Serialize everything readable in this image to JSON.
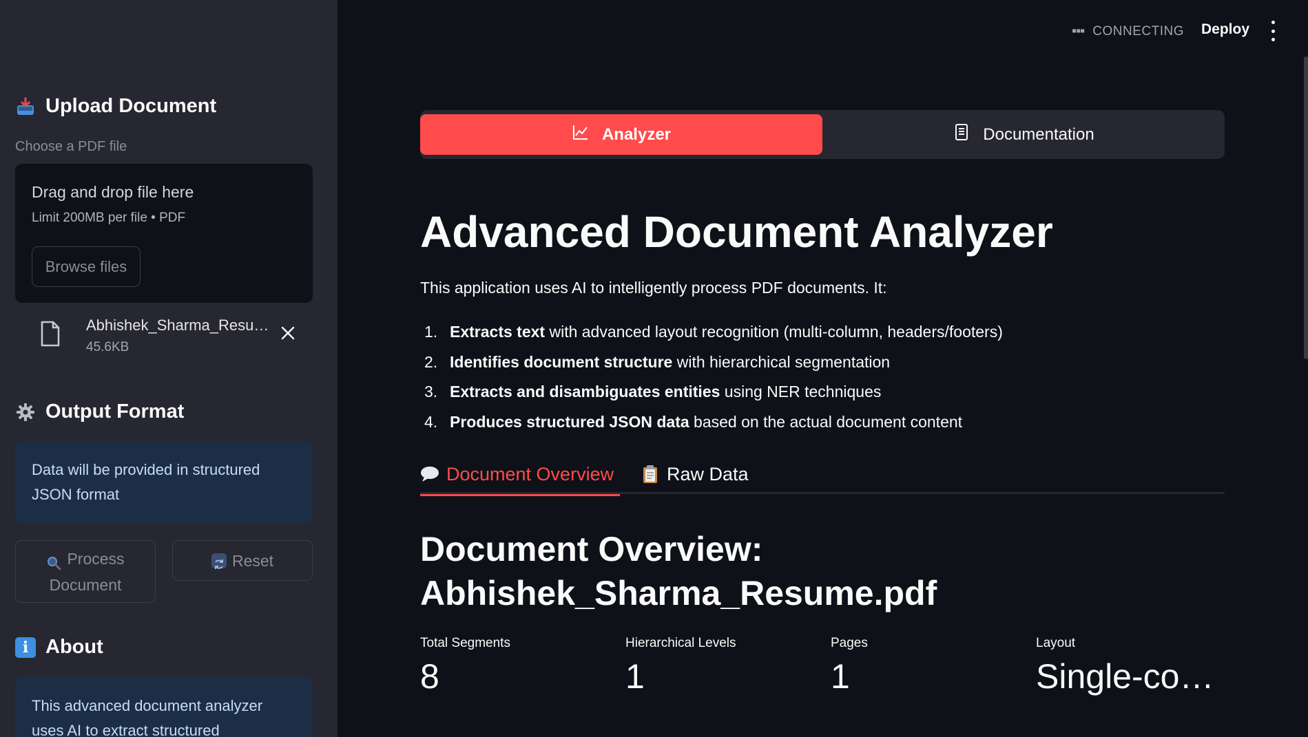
{
  "sidebar": {
    "upload_heading": "Upload Document",
    "file_label": "Choose a PDF file",
    "dropzone": {
      "title": "Drag and drop file here",
      "subtitle": "Limit 200MB per file • PDF",
      "browse_label": "Browse files"
    },
    "uploaded_file": {
      "name": "Abhishek_Sharma_Resu…",
      "size": "45.6KB"
    },
    "output_heading": "Output Format",
    "output_info": "Data will be provided in structured JSON format",
    "process_label": "Process Document",
    "reset_label": "Reset",
    "about_heading": "About",
    "about_text": "This advanced document analyzer uses AI to extract structured"
  },
  "header": {
    "status": "CONNECTING",
    "deploy_label": "Deploy"
  },
  "main": {
    "tabs": [
      {
        "label": "Analyzer",
        "active": true
      },
      {
        "label": "Documentation",
        "active": false
      }
    ],
    "title": "Advanced Document Analyzer",
    "intro": "This application uses AI to intelligently process PDF documents. It:",
    "features": [
      {
        "num": "1.",
        "bold": "Extracts text",
        "rest": " with advanced layout recognition (multi-column, headers/footers)"
      },
      {
        "num": "2.",
        "bold": "Identifies document structure",
        "rest": " with hierarchical segmentation"
      },
      {
        "num": "3.",
        "bold": "Extracts and disambiguates entities",
        "rest": " using NER techniques"
      },
      {
        "num": "4.",
        "bold": "Produces structured JSON data",
        "rest": " based on the actual document content"
      }
    ],
    "subtabs": [
      {
        "label": "Document Overview",
        "active": true
      },
      {
        "label": "Raw Data",
        "active": false
      }
    ],
    "overview_title_line1": "Document Overview:",
    "overview_title_line2": "Abhishek_Sharma_Resume.pdf",
    "metrics": [
      {
        "label": "Total Segments",
        "value": "8"
      },
      {
        "label": "Hierarchical Levels",
        "value": "1"
      },
      {
        "label": "Pages",
        "value": "1"
      },
      {
        "label": "Layout",
        "value": "Single-co…"
      }
    ]
  },
  "colors": {
    "accent": "#ff4b4b",
    "sidebar_bg": "#262730",
    "main_bg": "#0e1117",
    "info_bg": "#1c2e46"
  },
  "icons": [
    "inbox-tray-icon",
    "gear-icon",
    "info-icon",
    "document-icon",
    "close-icon",
    "chart-icon",
    "docs-icon",
    "speech-bubble-icon",
    "clipboard-icon",
    "magnifier-icon",
    "refresh-icon",
    "kebab-menu-icon"
  ]
}
